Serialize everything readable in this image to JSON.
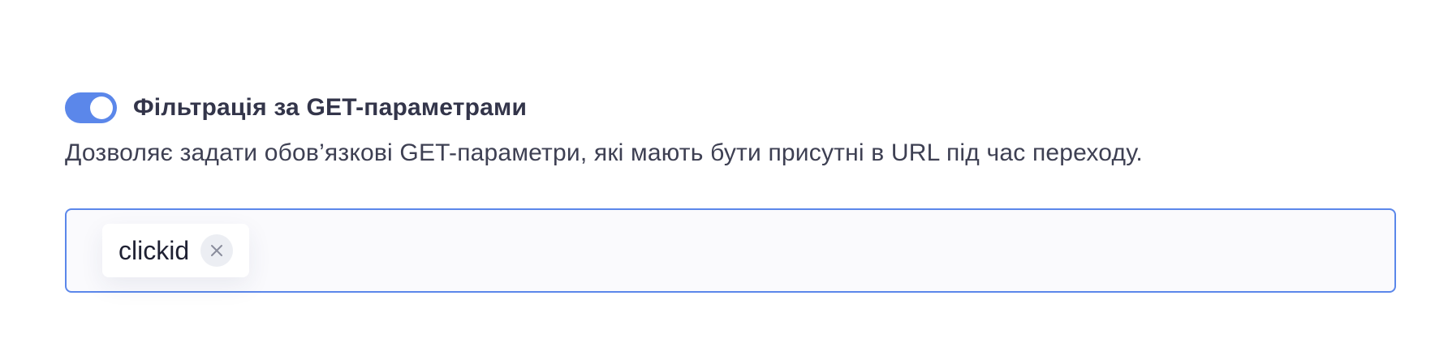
{
  "setting": {
    "enabled": true,
    "title": "Фільтрація за GET-параметрами",
    "description": "Дозволяє задати обов’язкові GET-параметри, які мають бути присутні в URL під час переходу."
  },
  "params_input": {
    "tags": [
      {
        "label": "clickid",
        "remove_icon": "close-icon"
      }
    ]
  },
  "colors": {
    "accent": "#5b87ea",
    "text": "#33354a",
    "input_background": "#fafafd"
  }
}
